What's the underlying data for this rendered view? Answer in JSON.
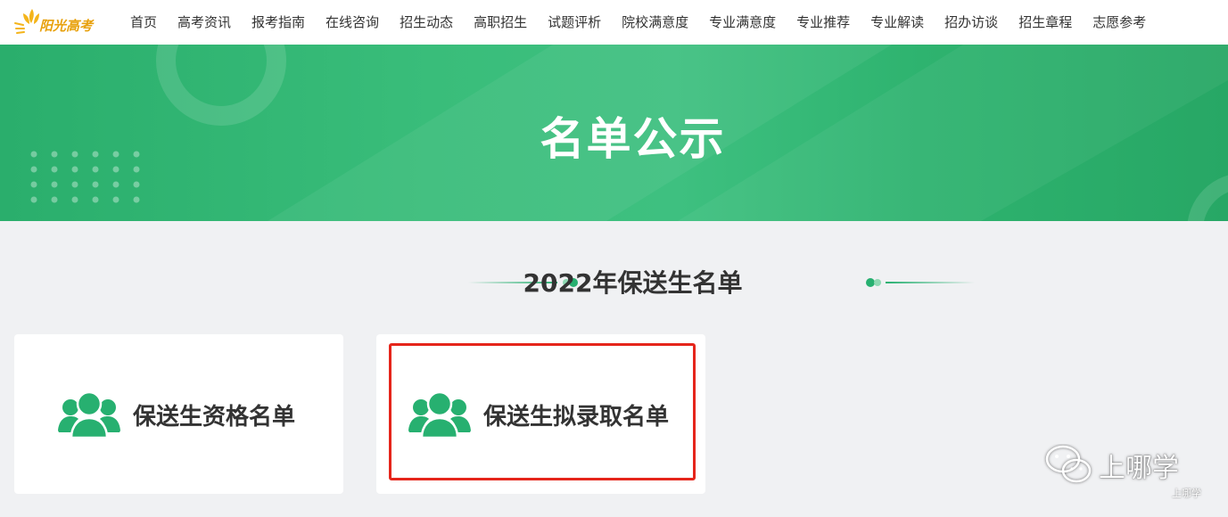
{
  "logo": {
    "text": "阳光高考",
    "icon": "sun-logo-icon"
  },
  "nav": {
    "items": [
      {
        "label": "首页"
      },
      {
        "label": "高考资讯"
      },
      {
        "label": "报考指南"
      },
      {
        "label": "在线咨询"
      },
      {
        "label": "招生动态"
      },
      {
        "label": "高职招生"
      },
      {
        "label": "试题评析"
      },
      {
        "label": "院校满意度"
      },
      {
        "label": "专业满意度"
      },
      {
        "label": "专业推荐"
      },
      {
        "label": "专业解读"
      },
      {
        "label": "招办访谈"
      },
      {
        "label": "招生章程"
      },
      {
        "label": "志愿参考"
      }
    ]
  },
  "banner": {
    "title": "名单公示"
  },
  "section": {
    "title": "2022年保送生名单"
  },
  "cards": [
    {
      "label": "保送生资格名单",
      "icon": "users-icon"
    },
    {
      "label": "保送生拟录取名单",
      "icon": "users-icon",
      "highlighted": true
    }
  ],
  "watermark": {
    "text": "上哪学",
    "small_text": "上哪学",
    "icon": "wechat-icon"
  },
  "colors": {
    "brand_green": "#27b070",
    "highlight_red": "#e5251b",
    "logo_orange": "#e8a10d",
    "text_dark": "#333333"
  }
}
